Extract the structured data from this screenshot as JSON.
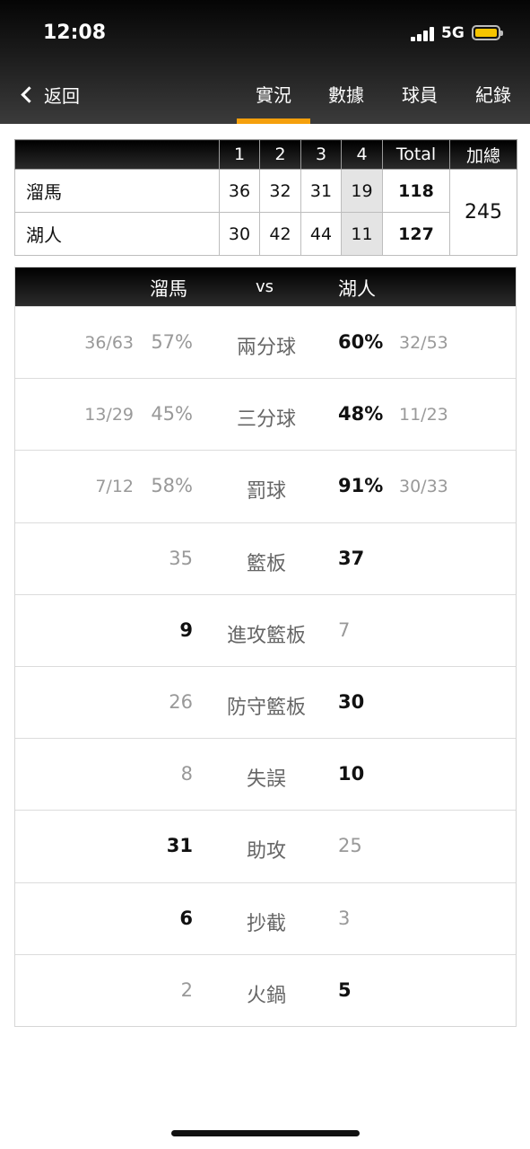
{
  "status_bar": {
    "time": "12:08",
    "network": "5G"
  },
  "nav": {
    "back_label": "返回",
    "tabs": [
      {
        "label": "實況",
        "active": true
      },
      {
        "label": "數據",
        "active": false
      },
      {
        "label": "球員",
        "active": false
      },
      {
        "label": "紀錄",
        "active": false
      }
    ]
  },
  "score_table": {
    "headers": [
      "",
      "1",
      "2",
      "3",
      "4",
      "Total",
      "加總"
    ],
    "combined_total": "245",
    "rows": [
      {
        "team": "溜馬",
        "q1": "36",
        "q2": "32",
        "q3": "31",
        "q4": "19",
        "total": "118"
      },
      {
        "team": "湖人",
        "q1": "30",
        "q2": "42",
        "q3": "44",
        "q4": "11",
        "total": "127"
      }
    ]
  },
  "comparison": {
    "left_team": "溜馬",
    "vs": "vs",
    "right_team": "湖人",
    "rows": [
      {
        "label": "兩分球",
        "left_frac": "36/63",
        "left": "57%",
        "right": "60%",
        "right_frac": "32/53",
        "winner": "right"
      },
      {
        "label": "三分球",
        "left_frac": "13/29",
        "left": "45%",
        "right": "48%",
        "right_frac": "11/23",
        "winner": "right"
      },
      {
        "label": "罰球",
        "left_frac": "7/12",
        "left": "58%",
        "right": "91%",
        "right_frac": "30/33",
        "winner": "right"
      },
      {
        "label": "籃板",
        "left_frac": "",
        "left": "35",
        "right": "37",
        "right_frac": "",
        "winner": "right"
      },
      {
        "label": "進攻籃板",
        "left_frac": "",
        "left": "9",
        "right": "7",
        "right_frac": "",
        "winner": "left"
      },
      {
        "label": "防守籃板",
        "left_frac": "",
        "left": "26",
        "right": "30",
        "right_frac": "",
        "winner": "right"
      },
      {
        "label": "失誤",
        "left_frac": "",
        "left": "8",
        "right": "10",
        "right_frac": "",
        "winner": "right"
      },
      {
        "label": "助攻",
        "left_frac": "",
        "left": "31",
        "right": "25",
        "right_frac": "",
        "winner": "left"
      },
      {
        "label": "抄截",
        "left_frac": "",
        "left": "6",
        "right": "3",
        "right_frac": "",
        "winner": "left"
      },
      {
        "label": "火鍋",
        "left_frac": "",
        "left": "2",
        "right": "5",
        "right_frac": "",
        "winner": "right"
      }
    ]
  },
  "colors": {
    "accent": "#f5a00c",
    "battery": "#f5c400",
    "header_dark": "#000000",
    "muted": "#999999"
  }
}
